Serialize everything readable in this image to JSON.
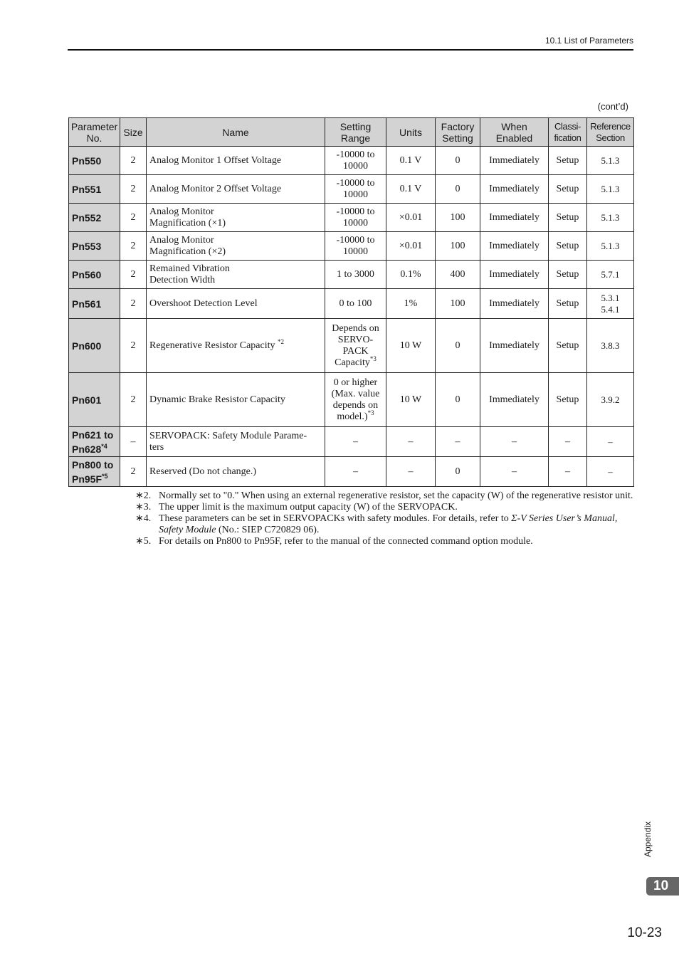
{
  "header": {
    "section_title": "10.1  List of Parameters"
  },
  "table": {
    "continued_label": "(cont’d)",
    "columns": [
      {
        "line1": "Parameter",
        "line2": "No."
      },
      {
        "line1": "Size",
        "line2": ""
      },
      {
        "line1": "Name",
        "line2": ""
      },
      {
        "line1": "Setting",
        "line2": "Range"
      },
      {
        "line1": "Units",
        "line2": ""
      },
      {
        "line1": "Factory",
        "line2": "Setting"
      },
      {
        "line1": "When",
        "line2": "Enabled"
      },
      {
        "line1": "Classi-",
        "line2": "fication"
      },
      {
        "line1": "Reference",
        "line2": "Section"
      }
    ],
    "rows": [
      {
        "param_no": "Pn550",
        "param_no2": "",
        "param_sup": "",
        "size": "2",
        "name": "Analog Monitor 1 Offset Voltage",
        "name2": "",
        "name_sup": "",
        "range": "-10000 to",
        "range2": "10000",
        "range3": "",
        "range4": "",
        "range_sup": "",
        "units": "0.1 V",
        "factory": "0",
        "when": "Immediately",
        "class": "Setup",
        "ref": "5.1.3",
        "ref2": ""
      },
      {
        "param_no": "Pn551",
        "param_no2": "",
        "param_sup": "",
        "size": "2",
        "name": "Analog Monitor 2 Offset Voltage",
        "name2": "",
        "name_sup": "",
        "range": "-10000 to",
        "range2": "10000",
        "range3": "",
        "range4": "",
        "range_sup": "",
        "units": "0.1 V",
        "factory": "0",
        "when": "Immediately",
        "class": "Setup",
        "ref": "5.1.3",
        "ref2": ""
      },
      {
        "param_no": "Pn552",
        "param_no2": "",
        "param_sup": "",
        "size": "2",
        "name": "Analog Monitor",
        "name2": "Magnification (×1)",
        "name_sup": "",
        "range": "-10000 to",
        "range2": "10000",
        "range3": "",
        "range4": "",
        "range_sup": "",
        "units": "×0.01",
        "factory": "100",
        "when": "Immediately",
        "class": "Setup",
        "ref": "5.1.3",
        "ref2": ""
      },
      {
        "param_no": "Pn553",
        "param_no2": "",
        "param_sup": "",
        "size": "2",
        "name": "Analog Monitor",
        "name2": "Magnification (×2)",
        "name_sup": "",
        "range": "-10000 to",
        "range2": "10000",
        "range3": "",
        "range4": "",
        "range_sup": "",
        "units": "×0.01",
        "factory": "100",
        "when": "Immediately",
        "class": "Setup",
        "ref": "5.1.3",
        "ref2": ""
      },
      {
        "param_no": "Pn560",
        "param_no2": "",
        "param_sup": "",
        "size": "2",
        "name": "Remained Vibration",
        "name2": "Detection Width",
        "name_sup": "",
        "range": "1 to 3000",
        "range2": "",
        "range3": "",
        "range4": "",
        "range_sup": "",
        "units": "0.1%",
        "factory": "400",
        "when": "Immediately",
        "class": "Setup",
        "ref": "5.7.1",
        "ref2": ""
      },
      {
        "param_no": "Pn561",
        "param_no2": "",
        "param_sup": "",
        "size": "2",
        "name": "Overshoot Detection Level",
        "name2": "",
        "name_sup": "",
        "range": "0 to 100",
        "range2": "",
        "range3": "",
        "range4": "",
        "range_sup": "",
        "units": "1%",
        "factory": "100",
        "when": "Immediately",
        "class": "Setup",
        "ref": "5.3.1",
        "ref2": "5.4.1"
      },
      {
        "param_no": "Pn600",
        "param_no2": "",
        "param_sup": "",
        "size": "2",
        "name": "Regenerative Resistor Capacity ",
        "name2": "",
        "name_sup": "*2",
        "range": "Depends on",
        "range2": "SERVO-",
        "range3": "PACK",
        "range4": "Capacity",
        "range_sup": "*3",
        "units": "10 W",
        "factory": "0",
        "when": "Immediately",
        "class": "Setup",
        "ref": "3.8.3",
        "ref2": ""
      },
      {
        "param_no": "Pn601",
        "param_no2": "",
        "param_sup": "",
        "size": "2",
        "name": "Dynamic Brake Resistor Capacity",
        "name2": "",
        "name_sup": "",
        "range": "0 or higher",
        "range2": "(Max. value",
        "range3": "depends on",
        "range4": "model.)",
        "range_sup": "*3",
        "units": "10 W",
        "factory": "0",
        "when": "Immediately",
        "class": "Setup",
        "ref": "3.9.2",
        "ref2": ""
      },
      {
        "param_no": "Pn621 to",
        "param_no2": "Pn628",
        "param_sup": "*4",
        "size": "–",
        "name": "SERVOPACK: Safety Module Parame-",
        "name2": "ters",
        "name_sup": "",
        "range": "–",
        "range2": "",
        "range3": "",
        "range4": "",
        "range_sup": "",
        "units": "–",
        "factory": "–",
        "when": "–",
        "class": "–",
        "ref": "–",
        "ref2": ""
      },
      {
        "param_no": "Pn800 to",
        "param_no2": "Pn95F",
        "param_sup": "*5",
        "size": "2",
        "name": "Reserved (Do not change.)",
        "name2": "",
        "name_sup": "",
        "range": "–",
        "range2": "",
        "range3": "",
        "range4": "",
        "range_sup": "",
        "units": "–",
        "factory": "0",
        "when": "–",
        "class": "–",
        "ref": "–",
        "ref2": ""
      }
    ]
  },
  "footnotes": [
    {
      "mark": "∗2.",
      "text": "Normally set to \"0.\" When using an external regenerative resistor, set the capacity (W) of the regenerative resistor unit."
    },
    {
      "mark": "∗3.",
      "text": "The upper limit is the maximum output capacity (W) of the SERVOPACK."
    },
    {
      "mark": "∗4.",
      "text_before": "These parameters can be set in SERVOPACKs with safety modules. For details, refer to ",
      "text_italic": "Σ-V Series User’s Manual, Safety Module",
      "text_after": " (No.: SIEP C720829 06)."
    },
    {
      "mark": "∗5.",
      "text": "For details on Pn800 to Pn95F, refer to the manual of the connected command option module."
    }
  ],
  "side": {
    "section_label": "Appendix",
    "chapter_number": "10"
  },
  "footer": {
    "page_number": "10-23"
  }
}
